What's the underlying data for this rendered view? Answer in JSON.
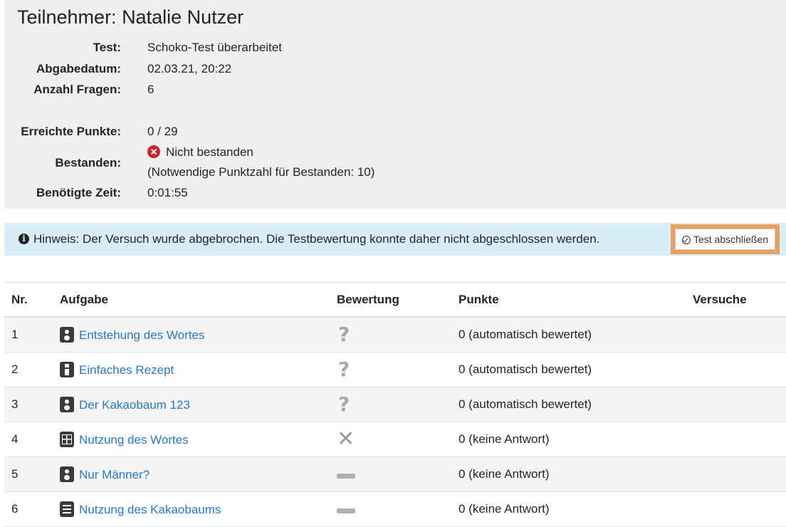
{
  "header": {
    "title": "Teilnehmer: Natalie Nutzer"
  },
  "details": {
    "test_label": "Test:",
    "test_value": "Schoko-Test überarbeitet",
    "date_label": "Abgabedatum:",
    "date_value": "02.03.21, 20:22",
    "questions_label": "Anzahl Fragen:",
    "questions_value": "6",
    "points_label": "Erreichte Punkte:",
    "points_value": "0 / 29",
    "passed_label": "Bestanden:",
    "passed_value": "Nicht bestanden",
    "passed_note": "(Notwendige Punktzahl für Bestanden: 10)",
    "time_label": "Benötigte Zeit:",
    "time_value": "0:01:55"
  },
  "alert": {
    "text": "Hinweis: Der Versuch wurde abgebrochen. Die Testbewertung konnte daher nicht abgeschlossen werden.",
    "button_label": "Test abschließen"
  },
  "table": {
    "headers": {
      "nr": "Nr.",
      "task": "Aufgabe",
      "eval": "Bewertung",
      "points": "Punkte",
      "attempts": "Versuche"
    },
    "rows": [
      {
        "nr": "1",
        "task": "Entstehung des Wortes",
        "type": "single-choice-icon",
        "eval": "question-mark-icon",
        "points": "0 (automatisch bewertet)"
      },
      {
        "nr": "2",
        "task": "Einfaches Rezept",
        "type": "freetext-icon",
        "eval": "question-mark-icon",
        "points": "0 (automatisch bewertet)"
      },
      {
        "nr": "3",
        "task": "Der Kakaobaum 123",
        "type": "single-choice-icon",
        "eval": "question-mark-icon",
        "points": "0 (automatisch bewertet)"
      },
      {
        "nr": "4",
        "task": "Nutzung des Wortes",
        "type": "matrix-icon",
        "eval": "cross-icon",
        "points": "0 (keine Antwort)"
      },
      {
        "nr": "5",
        "task": "Nur Männer?",
        "type": "single-choice-icon",
        "eval": "dash-icon",
        "points": "0 (keine Antwort)"
      },
      {
        "nr": "6",
        "task": "Nutzung des Kakaobaums",
        "type": "cloze-icon",
        "eval": "dash-icon",
        "points": "0 (keine Antwort)"
      }
    ]
  },
  "colors": {
    "summary_bg": "#efefef",
    "alert_bg": "#d9edf7",
    "link": "#2878c8",
    "highlight": "#e8a060",
    "fail": "#c62828"
  }
}
